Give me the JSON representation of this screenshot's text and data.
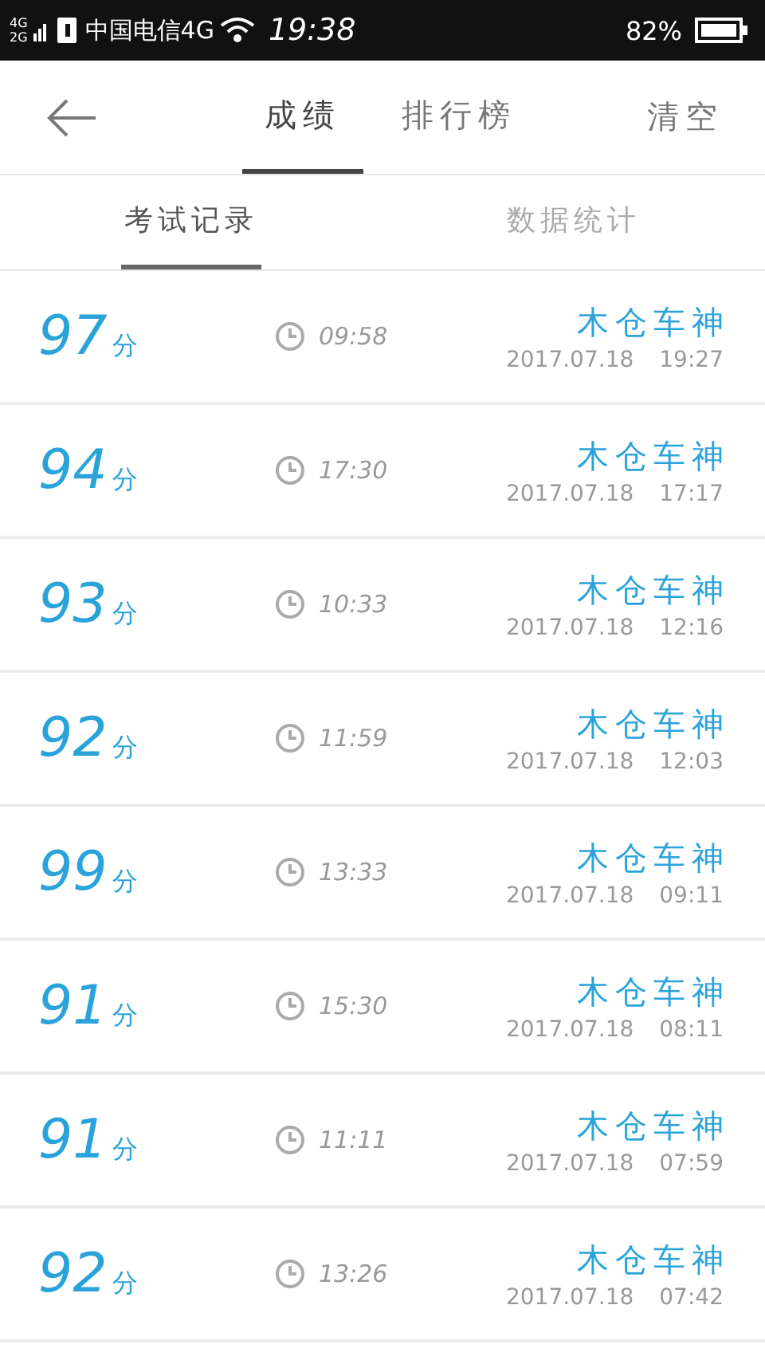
{
  "status_bar": {
    "network_top": "4G",
    "network_bottom": "2G",
    "carrier": "中国电信4G",
    "time": "19:38",
    "battery": "82%"
  },
  "header": {
    "tabs": [
      {
        "label": "成绩",
        "selected": true
      },
      {
        "label": "排行榜",
        "selected": false
      }
    ],
    "action": "清空"
  },
  "sub_tabs": [
    {
      "label": "考试记录",
      "selected": true
    },
    {
      "label": "数据统计",
      "selected": false
    }
  ],
  "records": [
    {
      "score": "97",
      "unit": "分",
      "duration": "09:58",
      "name": "木仓车神",
      "date": "2017.07.18",
      "time": "19:27"
    },
    {
      "score": "94",
      "unit": "分",
      "duration": "17:30",
      "name": "木仓车神",
      "date": "2017.07.18",
      "time": "17:17"
    },
    {
      "score": "93",
      "unit": "分",
      "duration": "10:33",
      "name": "木仓车神",
      "date": "2017.07.18",
      "time": "12:16"
    },
    {
      "score": "92",
      "unit": "分",
      "duration": "11:59",
      "name": "木仓车神",
      "date": "2017.07.18",
      "time": "12:03"
    },
    {
      "score": "99",
      "unit": "分",
      "duration": "13:33",
      "name": "木仓车神",
      "date": "2017.07.18",
      "time": "09:11"
    },
    {
      "score": "91",
      "unit": "分",
      "duration": "15:30",
      "name": "木仓车神",
      "date": "2017.07.18",
      "time": "08:11"
    },
    {
      "score": "91",
      "unit": "分",
      "duration": "11:11",
      "name": "木仓车神",
      "date": "2017.07.18",
      "time": "07:59"
    },
    {
      "score": "92",
      "unit": "分",
      "duration": "13:26",
      "name": "木仓车神",
      "date": "2017.07.18",
      "time": "07:42"
    }
  ]
}
